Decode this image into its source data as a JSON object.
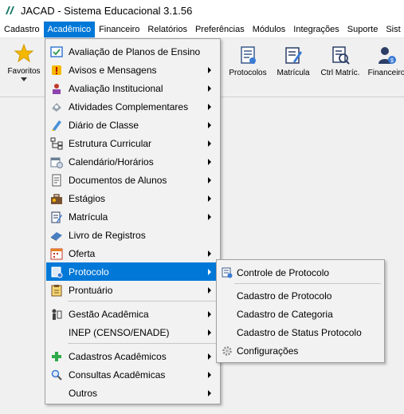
{
  "window": {
    "title": "JACAD - Sistema Educacional 3.1.56"
  },
  "menubar": {
    "items": [
      {
        "label": "Cadastro"
      },
      {
        "label": "Acadêmico"
      },
      {
        "label": "Financeiro"
      },
      {
        "label": "Relatórios"
      },
      {
        "label": "Preferências"
      },
      {
        "label": "Módulos"
      },
      {
        "label": "Integrações"
      },
      {
        "label": "Suporte"
      },
      {
        "label": "Sist"
      }
    ],
    "active_color": "#0078d7"
  },
  "toolbar": {
    "favoritos": {
      "label": "Favoritos",
      "icon": "star-icon"
    },
    "buttons": [
      {
        "label": "Protocolos",
        "icon": "protocol-icon"
      },
      {
        "label": "Matrícula",
        "icon": "enrollment-icon"
      },
      {
        "label": "Ctrl Matríc.",
        "icon": "enrollment-control-icon"
      },
      {
        "label": "Financeiro",
        "icon": "finance-icon"
      }
    ]
  },
  "academico_menu": {
    "items": [
      {
        "label": "Avaliação de Planos de Ensino",
        "icon": "plan-evaluation-icon"
      },
      {
        "label": "Avisos e Mensagens",
        "icon": "warning-icon"
      },
      {
        "label": "Avaliação Institucional",
        "icon": "person-evaluation-icon"
      },
      {
        "label": "Atividades Complementares",
        "icon": "activities-icon"
      },
      {
        "label": "Diário de Classe",
        "icon": "diary-icon"
      },
      {
        "label": "Estrutura Curricular",
        "icon": "structure-icon"
      },
      {
        "label": "Calendário/Horários",
        "icon": "calendar-icon"
      },
      {
        "label": "Documentos de Alunos",
        "icon": "documents-icon"
      },
      {
        "label": "Estágios",
        "icon": "internship-icon"
      },
      {
        "label": "Matrícula",
        "icon": "enrollment-icon"
      },
      {
        "label": "Livro de Registros",
        "icon": "book-icon"
      },
      {
        "label": "Oferta",
        "icon": "offer-icon"
      },
      {
        "label": "Protocolo",
        "icon": "protocol-icon"
      },
      {
        "label": "Prontuário",
        "icon": "record-icon"
      },
      {
        "label": "Gestão Acadêmica",
        "icon": "management-icon"
      },
      {
        "label": "INEP (CENSO/ENADE)",
        "icon": ""
      },
      {
        "label": "Cadastros Acadêmicos",
        "icon": "plus-icon"
      },
      {
        "label": "Consultas Acadêmicas",
        "icon": "search-icon"
      },
      {
        "label": "Outros",
        "icon": ""
      }
    ],
    "highlight_color": "#0078d7"
  },
  "protocolo_submenu": {
    "items": [
      {
        "label": "Controle de Protocolo",
        "icon": "protocol-control-icon"
      },
      {
        "label": "Cadastro de Protocolo"
      },
      {
        "label": "Cadastro de Categoria"
      },
      {
        "label": "Cadastro de Status Protocolo"
      },
      {
        "label": "Configurações",
        "icon": "gear-icon"
      }
    ]
  }
}
